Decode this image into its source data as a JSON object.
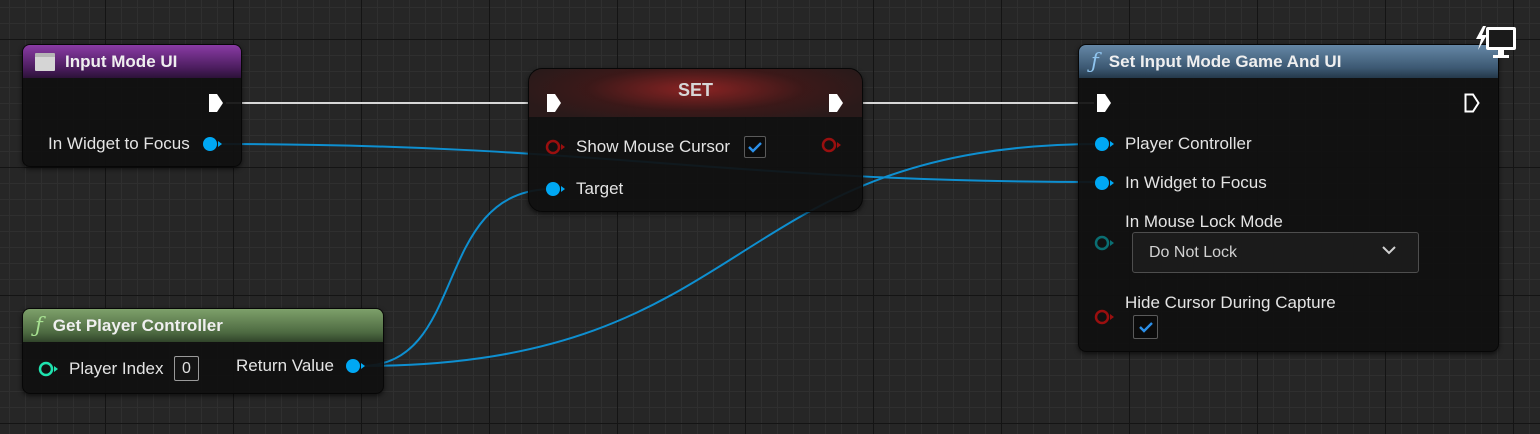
{
  "nodes": {
    "input_mode_ui": {
      "title": "Input Mode UI",
      "pins": {
        "in_widget_to_focus": "In Widget to Focus"
      }
    },
    "set_node": {
      "title": "SET",
      "pins": {
        "show_mouse_cursor": "Show Mouse Cursor",
        "target": "Target"
      },
      "show_mouse_cursor_checked": true
    },
    "get_player_controller": {
      "title": "Get Player Controller",
      "pins": {
        "player_index": "Player Index",
        "return_value": "Return Value"
      },
      "player_index_value": "0"
    },
    "set_input_mode": {
      "title": "Set Input Mode Game And UI",
      "pins": {
        "player_controller": "Player Controller",
        "in_widget_to_focus": "In Widget to Focus",
        "in_mouse_lock_mode": "In Mouse Lock Mode",
        "hide_cursor_during_capture": "Hide Cursor During Capture"
      },
      "mouse_lock_mode_value": "Do Not Lock",
      "hide_cursor_checked": true
    }
  },
  "colors": {
    "object_pin": "#00a8f4",
    "bool_pin": "#920101",
    "integer_pin": "#1fe3af",
    "enum_pin": "#006575",
    "exec_wire": "#ffffff"
  },
  "icons": {
    "exec_pin": "exec-arrow-icon",
    "function": "function-f-icon",
    "widget": "widget-icon",
    "monitor": "monitor-icon",
    "dropdown": "chevron-down-icon",
    "check": "checkmark-icon"
  }
}
